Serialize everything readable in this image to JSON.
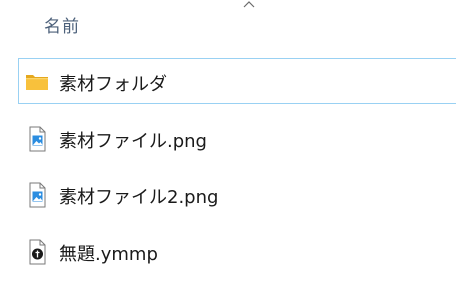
{
  "header": {
    "name_column": "名前",
    "sort_indicator_icon": "chevron-up-icon"
  },
  "files": [
    {
      "name": "素材フォルダ",
      "icon": "folder-icon",
      "selected": true
    },
    {
      "name": "素材ファイル.png",
      "icon": "image-file-icon",
      "selected": false
    },
    {
      "name": "素材ファイル2.png",
      "icon": "image-file-icon",
      "selected": false
    },
    {
      "name": "無題.ymmp",
      "icon": "ymmp-file-icon",
      "selected": false
    }
  ],
  "colors": {
    "selection_border": "#99d1f3",
    "header_text": "#4c607a",
    "folder_yellow": "#f8c13c",
    "image_blue": "#2b8de0"
  }
}
